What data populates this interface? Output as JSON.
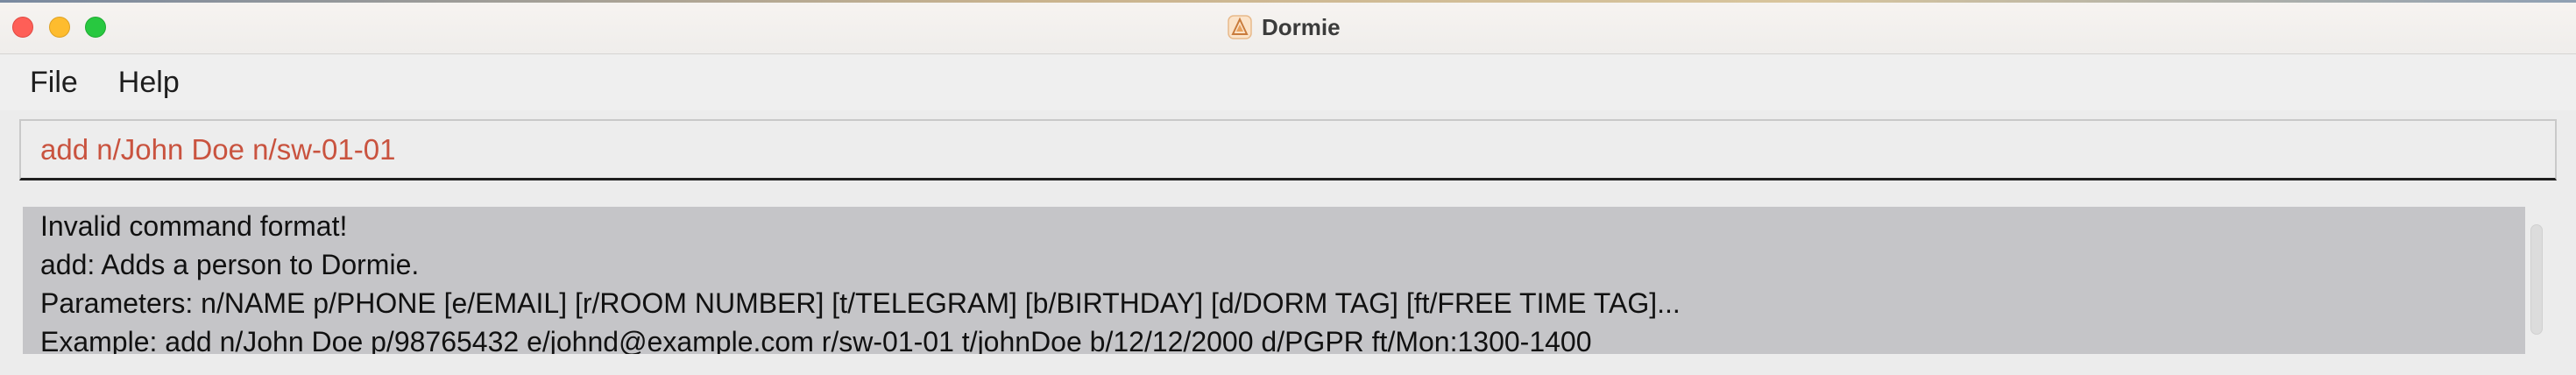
{
  "window": {
    "title": "Dormie",
    "app_icon": "dormie-logo-icon",
    "controls": {
      "close_icon": "close-icon",
      "minimize_icon": "minimize-icon",
      "maximize_icon": "maximize-icon"
    }
  },
  "menu": {
    "items": [
      {
        "label": "File"
      },
      {
        "label": "Help"
      }
    ]
  },
  "command": {
    "value": "add n/John Doe n/sw-01-01",
    "text_color": "#c9533f"
  },
  "result": {
    "lines": [
      "Invalid command format!",
      "add: Adds a person to Dormie.",
      "Parameters: n/NAME p/PHONE [e/EMAIL] [r/ROOM NUMBER] [t/TELEGRAM] [b/BIRTHDAY] [d/DORM TAG] [ft/FREE TIME TAG]...",
      "Example: add n/John Doe p/98765432 e/johnd@example.com r/sw-01-01 t/johnDoe b/12/12/2000 d/PGPR ft/Mon:1300-1400"
    ]
  },
  "colors": {
    "close": "#fe5f57",
    "minimize": "#febc2e",
    "maximize": "#28c840",
    "result_background": "#c5c5c8"
  }
}
